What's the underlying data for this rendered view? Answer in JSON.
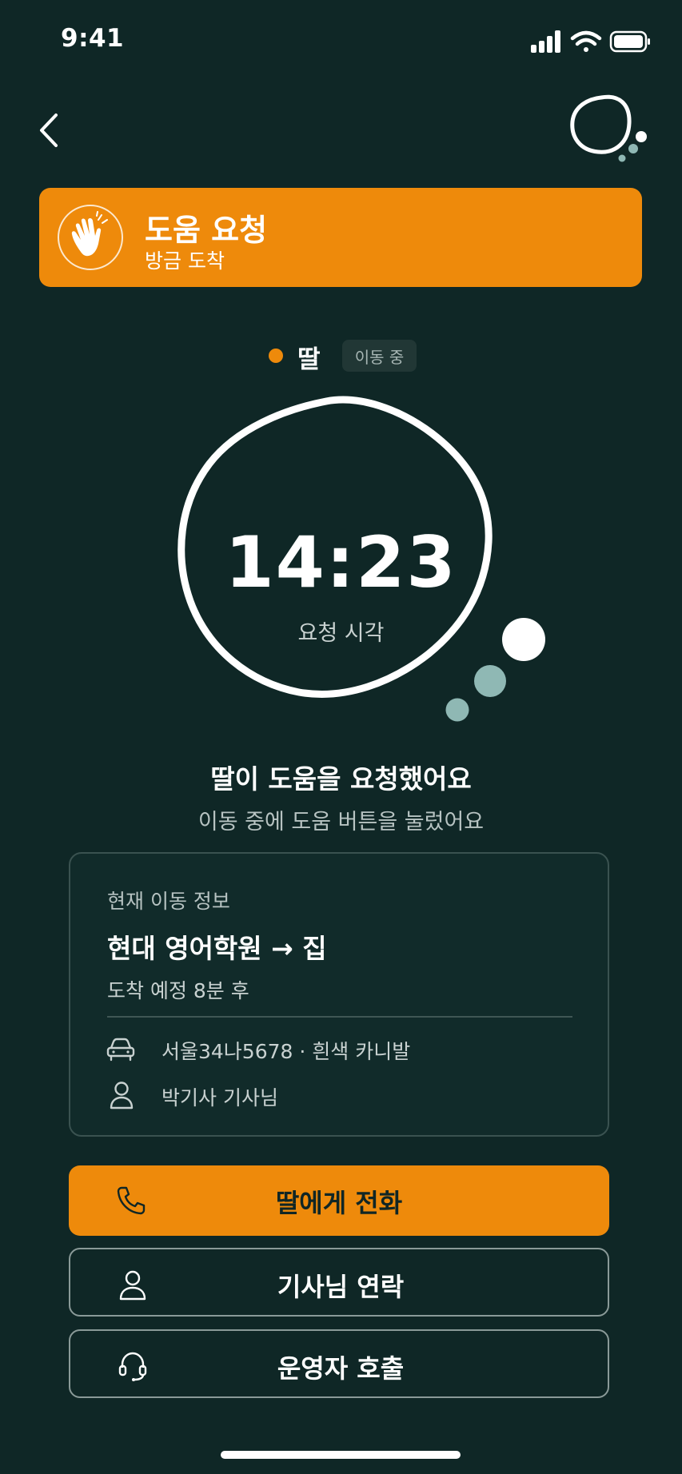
{
  "status_bar": {
    "time": "9:41",
    "icons": [
      "signal-icon",
      "wifi-icon",
      "battery-icon"
    ]
  },
  "header": {
    "back_icon": "chevron-left-icon",
    "logo_icon": "bubble-logo-icon"
  },
  "banner": {
    "title": "도움 요청",
    "subtitle": "방금 도착",
    "icon": "waving-hand-icon",
    "color": "#ee8a0b"
  },
  "person": {
    "name": "딸",
    "status": "이동 중",
    "dot_color": "#ee8a0b"
  },
  "request_time": {
    "value": "14:23",
    "label": "요청 시각"
  },
  "message": {
    "headline": "딸이 도움을 요청했어요",
    "detail": "이동 중에 도움 버튼을 눌렀어요"
  },
  "trip_card": {
    "label": "현재 이동 정보",
    "route": "현대 영어학원 → 집",
    "eta": "도착 예정 8분 후",
    "vehicle": "서울34나5678 · 흰색 카니발",
    "driver": "박기사 기사님"
  },
  "actions": {
    "call_daughter": "딸에게 전화",
    "contact_driver": "기사님 연락",
    "call_operator": "운영자 호출"
  },
  "colors": {
    "background": "#0f2726",
    "accent": "#ee8a0b",
    "card_border": "#3a5250"
  }
}
